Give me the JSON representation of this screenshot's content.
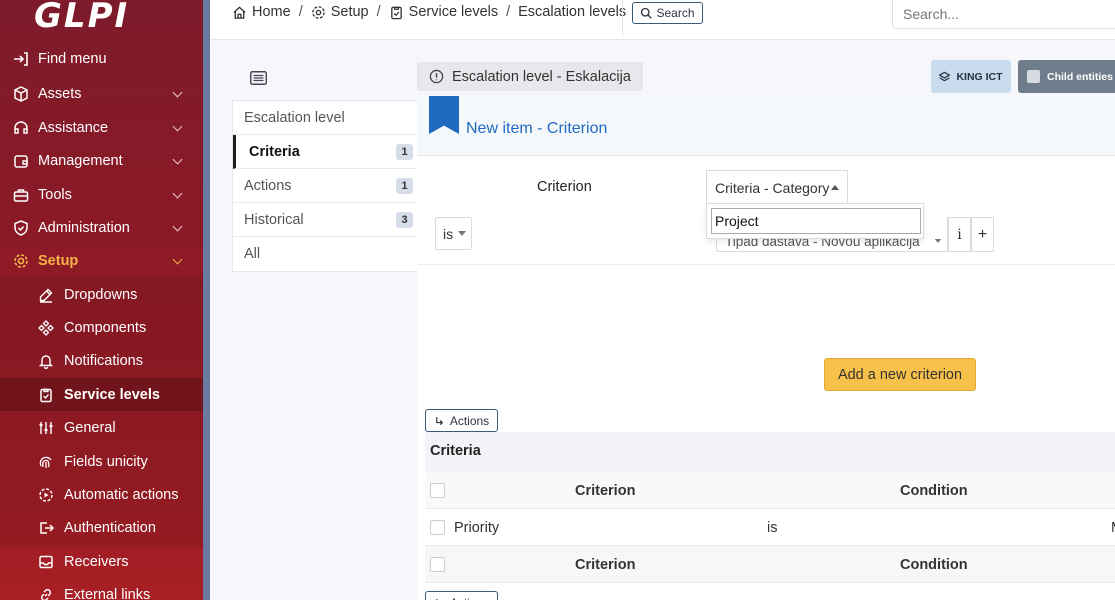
{
  "app": {
    "logo": "GLPI"
  },
  "sidebar": {
    "items": [
      {
        "label": "Find menu",
        "icon": "arrow-right-to-bracket-icon"
      },
      {
        "label": "Assets",
        "icon": "cube-icon"
      },
      {
        "label": "Assistance",
        "icon": "headset-icon"
      },
      {
        "label": "Management",
        "icon": "wallet-icon"
      },
      {
        "label": "Tools",
        "icon": "briefcase-icon"
      },
      {
        "label": "Administration",
        "icon": "shield-icon"
      },
      {
        "label": "Setup",
        "icon": "gear-icon"
      }
    ],
    "subitems": [
      {
        "label": "Dropdowns",
        "icon": "edit-icon"
      },
      {
        "label": "Components",
        "icon": "components-icon"
      },
      {
        "label": "Notifications",
        "icon": "bell-icon"
      },
      {
        "label": "Service levels",
        "icon": "clipboard-check-icon"
      },
      {
        "label": "General",
        "icon": "sliders-icon"
      },
      {
        "label": "Fields unicity",
        "icon": "fingerprint-icon"
      },
      {
        "label": "Automatic actions",
        "icon": "gear-play-icon"
      },
      {
        "label": "Authentication",
        "icon": "login-icon"
      },
      {
        "label": "Receivers",
        "icon": "inbox-icon"
      },
      {
        "label": "External links",
        "icon": "link-icon"
      }
    ]
  },
  "header": {
    "breadcrumb": [
      {
        "label": "Home",
        "icon": "home-icon"
      },
      {
        "label": "Setup",
        "icon": "gear-icon"
      },
      {
        "label": "Service levels",
        "icon": "clipboard-check-icon"
      },
      {
        "label": "Escalation levels"
      }
    ],
    "search_button": "Search",
    "search_placeholder": "Search..."
  },
  "content": {
    "item_title": "Escalation level - Eskalacija",
    "entity": "KING ICT",
    "child_entities": "Child entities",
    "tabs": [
      {
        "label": "Escalation level",
        "count": ""
      },
      {
        "label": "Criteria",
        "count": "1"
      },
      {
        "label": "Actions",
        "count": "1"
      },
      {
        "label": "Historical",
        "count": "3"
      },
      {
        "label": "All",
        "count": ""
      }
    ],
    "form": {
      "title": "New item - Criterion",
      "criterion_label": "Criterion",
      "criterion_value": "Criteria - Category",
      "search_value": "Project",
      "condition_value": "is",
      "pattern_value": "Tipad dastava - Novou aplikacija",
      "info": "i",
      "plus": "+",
      "add_button": "Add a new criterion"
    },
    "table": {
      "actions_label": "Actions",
      "title": "Criteria",
      "columns": [
        "Criterion",
        "Condition"
      ],
      "rows": [
        {
          "criterion": "Priority",
          "condition": "is",
          "pattern": "M"
        }
      ]
    }
  },
  "colors": {
    "sidebar": "#8c1a26",
    "accent": "#f6b24a",
    "link": "#1f69c1",
    "primary_button": "#f7c14a"
  }
}
